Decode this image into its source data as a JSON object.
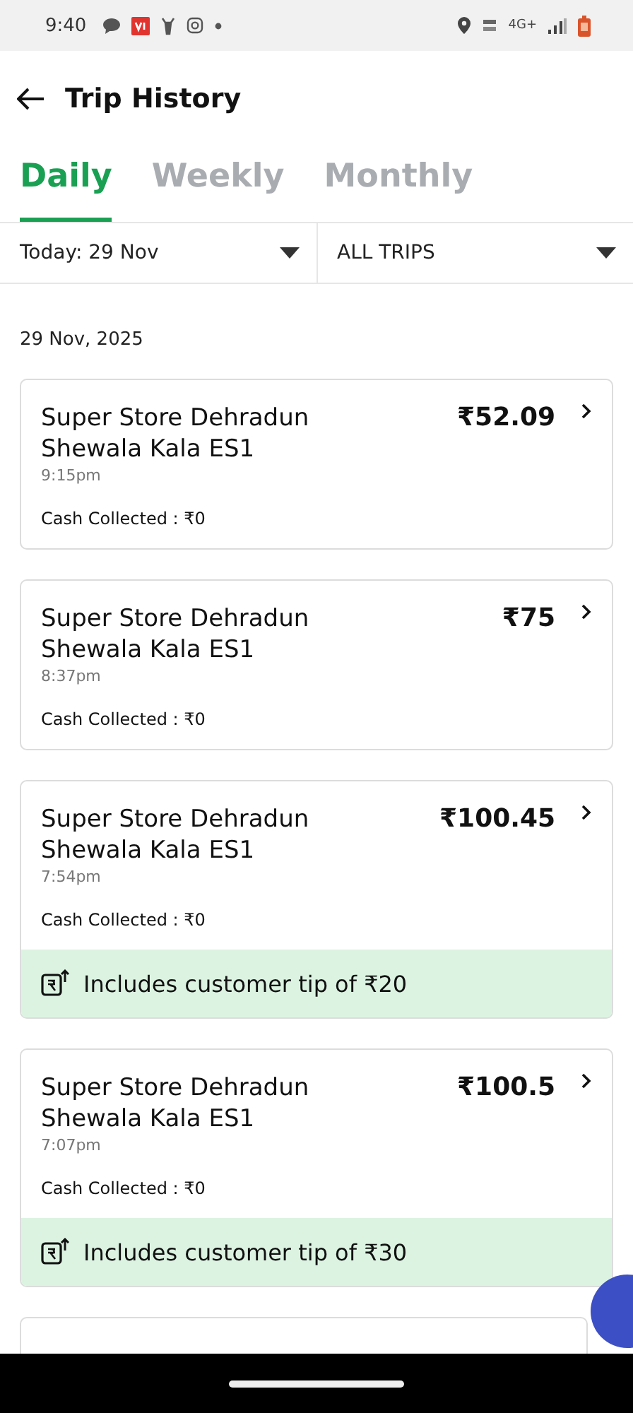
{
  "status_bar": {
    "time": "9:40",
    "network": "4G+"
  },
  "header": {
    "title": "Trip History"
  },
  "tabs": [
    {
      "label": "Daily",
      "selected": true
    },
    {
      "label": "Weekly",
      "selected": false
    },
    {
      "label": "Monthly",
      "selected": false
    }
  ],
  "filters": [
    {
      "label": "Today: 29 Nov"
    },
    {
      "label": "ALL TRIPS"
    }
  ],
  "date_heading": "29 Nov, 2025",
  "trips": [
    {
      "store": "Super Store Dehradun Shewala Kala ES1",
      "time": "9:15pm",
      "amount": "₹52.09",
      "cash": "Cash Collected : ₹0"
    },
    {
      "store": "Super Store Dehradun Shewala Kala ES1",
      "time": "8:37pm",
      "amount": "₹75",
      "cash": "Cash Collected : ₹0"
    },
    {
      "store": "Super Store Dehradun Shewala Kala ES1",
      "time": "7:54pm",
      "amount": "₹100.45",
      "cash": "Cash Collected : ₹0",
      "tip": "Includes customer tip of ₹20"
    },
    {
      "store": "Super Store Dehradun Shewala Kala ES1",
      "time": "7:07pm",
      "amount": "₹100.5",
      "cash": "Cash Collected : ₹0",
      "tip": "Includes customer tip of ₹30"
    }
  ]
}
